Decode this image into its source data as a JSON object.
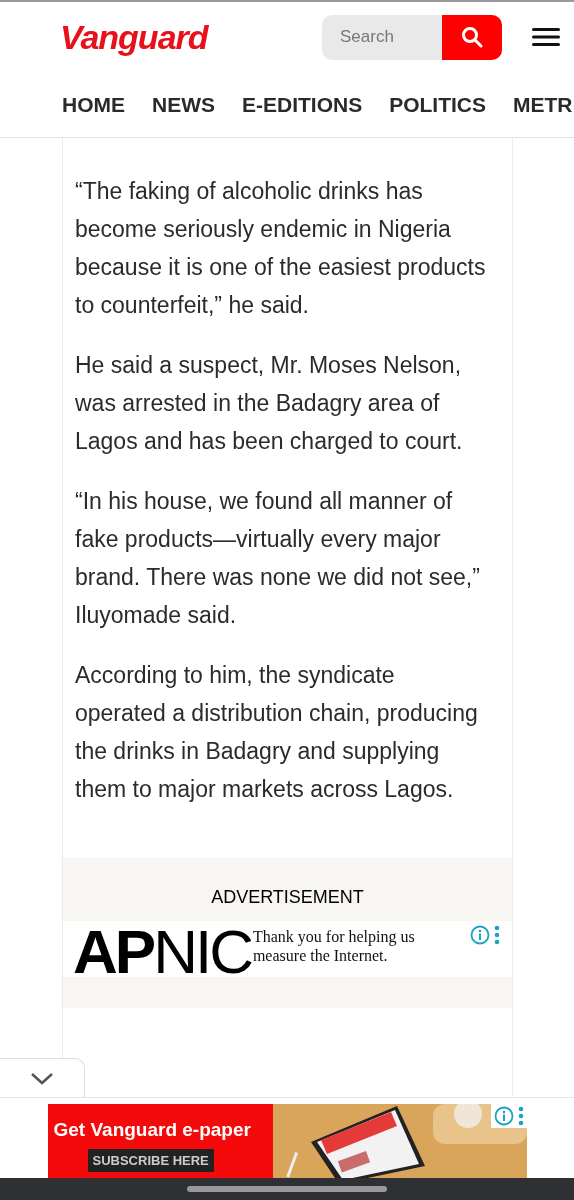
{
  "header": {
    "logo": "Vanguard",
    "search": {
      "placeholder": "Search"
    }
  },
  "nav": [
    {
      "label": "HOME"
    },
    {
      "label": "NEWS"
    },
    {
      "label": "E-EDITIONS"
    },
    {
      "label": "POLITICS"
    },
    {
      "label": "METR"
    }
  ],
  "article": {
    "paragraphs": [
      "“The faking of alcoholic drinks has become seriously endemic in Nigeria because it is one of the easiest products to counterfeit,” he said.",
      "He said a suspect, Mr. Moses Nelson, was arrested in the Badagry area of Lagos and has been charged to court.",
      "“In his house, we found all manner of fake products—virtually every major brand. There was none we did not see,” Iluyomade said.",
      "According to him, the syndicate operated a distribution chain, producing the drinks in Badagry and supplying them to major markets across Lagos."
    ]
  },
  "advertisement": {
    "label": "ADVERTISEMENT",
    "logo": "**AP**NIC",
    "message": "Thank you for helping us measure the Internet."
  },
  "bottom_ad": {
    "headline": "Get Vanguard e-paper",
    "button": "SUBSCRIBE HERE"
  }
}
